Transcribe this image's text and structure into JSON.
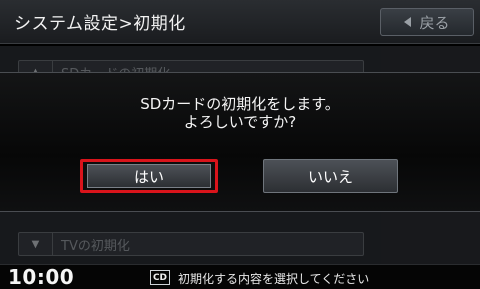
{
  "header": {
    "title": "システム設定>初期化",
    "back_label": "戻る"
  },
  "list": {
    "items": [
      {
        "label": "SDカードの初期化"
      },
      {
        "label": "TVの初期化"
      }
    ]
  },
  "dialog": {
    "message_line1": "SDカードの初期化をします。",
    "message_line2": "よろしいですか?",
    "yes_label": "はい",
    "no_label": "いいえ"
  },
  "status": {
    "time": "10:00",
    "media_label": "CD",
    "hint": "初期化する内容を選択してください"
  },
  "colors": {
    "focus": "#d9141b"
  }
}
